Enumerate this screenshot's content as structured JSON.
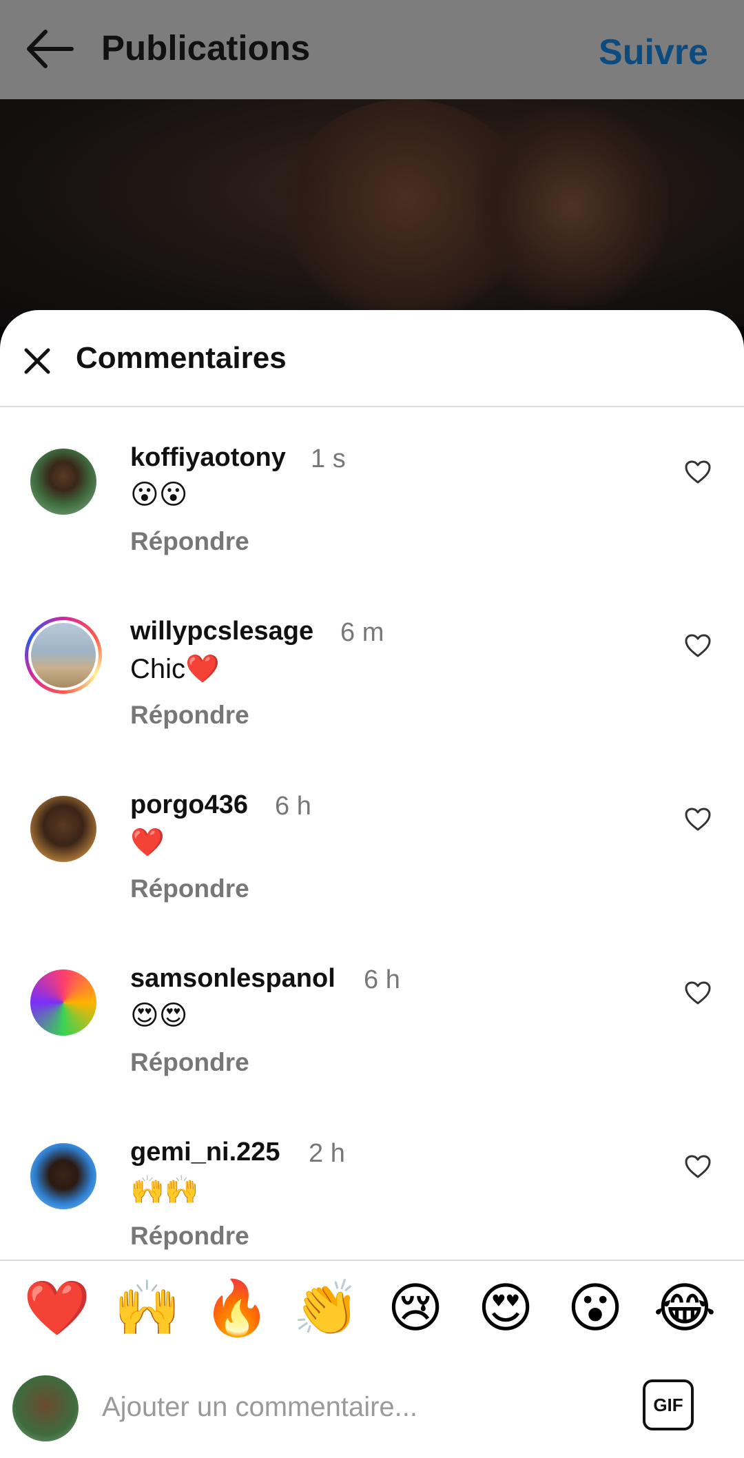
{
  "topbar": {
    "title": "Publications",
    "follow_label": "Suivre",
    "back_icon": "arrow-left-icon"
  },
  "sheet": {
    "title": "Commentaires",
    "close_icon": "close-icon"
  },
  "comments": [
    {
      "username": "koffiyaotony",
      "time": "1 s",
      "text": "😮😮",
      "reply": "Répondre"
    },
    {
      "username": "willypcslesage",
      "time": "6 m",
      "text": "Chic❤️",
      "reply": "Répondre"
    },
    {
      "username": "porgo436",
      "time": "6 h",
      "text": "❤️",
      "reply": "Répondre"
    },
    {
      "username": "samsonlespanol",
      "time": "6 h",
      "text": "😍😍",
      "reply": "Répondre"
    },
    {
      "username": "gemi_ni.225",
      "time": "2 h",
      "text": "🙌🙌",
      "reply": "Répondre"
    }
  ],
  "quick_emojis": [
    "❤️",
    "🙌",
    "🔥",
    "👏",
    "😢",
    "😍",
    "😮",
    "😂"
  ],
  "composer": {
    "placeholder": "Ajouter un commentaire...",
    "gif_label": "GIF"
  },
  "colors": {
    "follow": "#0b4b7e",
    "topbar_bg": "#7d7d7d",
    "muted_text": "#777777"
  }
}
